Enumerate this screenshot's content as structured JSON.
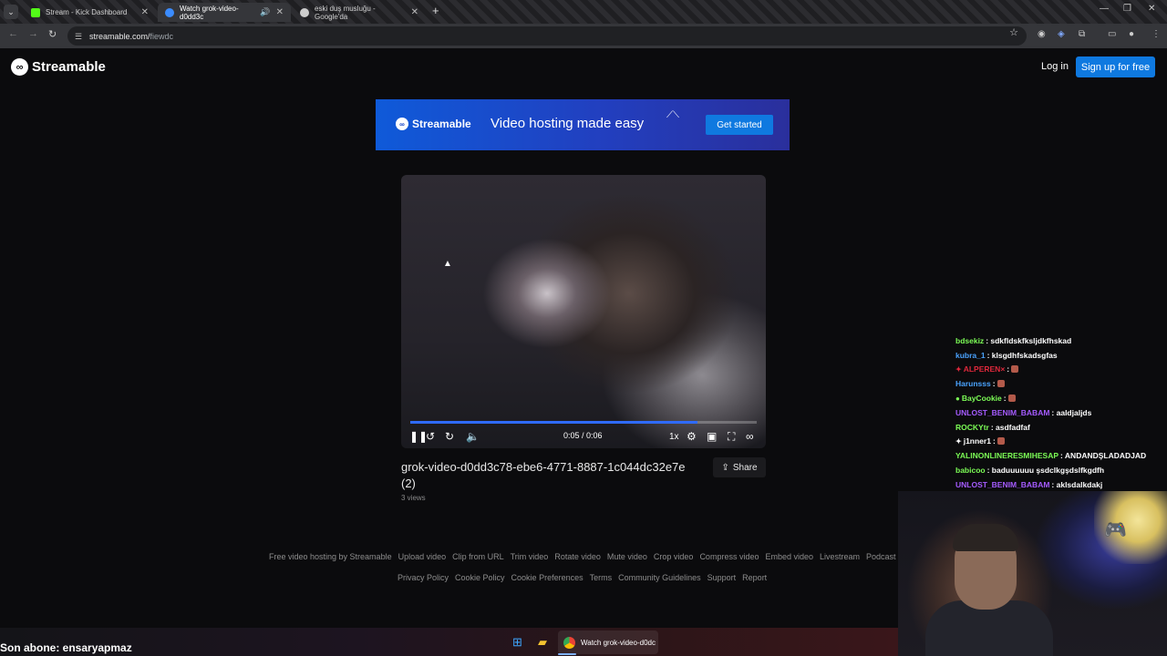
{
  "browser": {
    "tabs": [
      {
        "title": "Stream - Kick Dashboard",
        "favicon_color": "#53fc18"
      },
      {
        "title": "Watch grok-video-d0dd3c",
        "favicon_color": "#3b8cff"
      },
      {
        "title": "eski duş musluğu - Google'da",
        "favicon_color": "#cccccc"
      }
    ],
    "url_host": "streamable.com/",
    "url_path": "fiewdc"
  },
  "site": {
    "brand": "Streamable",
    "login": "Log in",
    "signup": "Sign up for free"
  },
  "banner": {
    "brand": "Streamable",
    "tagline": "Video hosting made easy",
    "cta": "Get started"
  },
  "video": {
    "time": "0:05 / 0:06",
    "progress": 0.83,
    "speed": "1x",
    "title": "grok-video-d0dd3c78-ebe6-4771-8887-1c044dc32e7e (2)",
    "views": "3 views",
    "share": "Share"
  },
  "footer": {
    "row1": [
      "Free video hosting by Streamable",
      "Upload video",
      "Clip from URL",
      "Trim video",
      "Rotate video",
      "Mute video",
      "Crop video",
      "Compress video",
      "Embed video",
      "Livestream",
      "Podcast"
    ],
    "row2": [
      "Privacy Policy",
      "Cookie Policy",
      "Cookie Preferences",
      "Terms",
      "Community Guidelines",
      "Support",
      "Report"
    ]
  },
  "chat": [
    {
      "user": "bdsekiz",
      "color": "#7cfc56",
      "msg": ": sdkfldskfksljdkfhskad",
      "badge": ""
    },
    {
      "user": "kubra_1",
      "color": "#4aa3ff",
      "msg": ": klsgdhfskadsgfas",
      "badge": ""
    },
    {
      "user": "ALPEREN×",
      "color": "#e0283c",
      "msg": ":",
      "badge": "✦",
      "emote": true
    },
    {
      "user": "Harunsss",
      "color": "#4aa3ff",
      "msg": ":",
      "badge": "",
      "emote": true
    },
    {
      "user": "BayCookie",
      "color": "#7cfc56",
      "msg": ":",
      "badge": "●",
      "emote": true
    },
    {
      "user": "UNLOST_BENIM_BABAM",
      "color": "#a55bff",
      "msg": ": aaldjaljds",
      "badge": ""
    },
    {
      "user": "ROCKYtr",
      "color": "#7cfc56",
      "msg": ": asdfadfaf",
      "badge": ""
    },
    {
      "user": "j1nner1",
      "color": "#ffffff",
      "msg": ":",
      "badge": "✦",
      "emote": true
    },
    {
      "user": "YALINONLINERESMIHESAP",
      "color": "#7cfc56",
      "msg": ": ANDANDŞLADADJAD",
      "badge": ""
    },
    {
      "user": "babicoo",
      "color": "#7cfc56",
      "msg": ": baduuuuuu şsdclkgşdslfkgdfh",
      "badge": ""
    },
    {
      "user": "UNLOST_BENIM_BABAM",
      "color": "#a55bff",
      "msg": ": aklsdalkdakj",
      "badge": ""
    }
  ],
  "overlay": {
    "sub_alert": "Son abone: ensaryapmaz"
  },
  "taskbar": {
    "active_app": "Watch grok-video-d0dc"
  }
}
